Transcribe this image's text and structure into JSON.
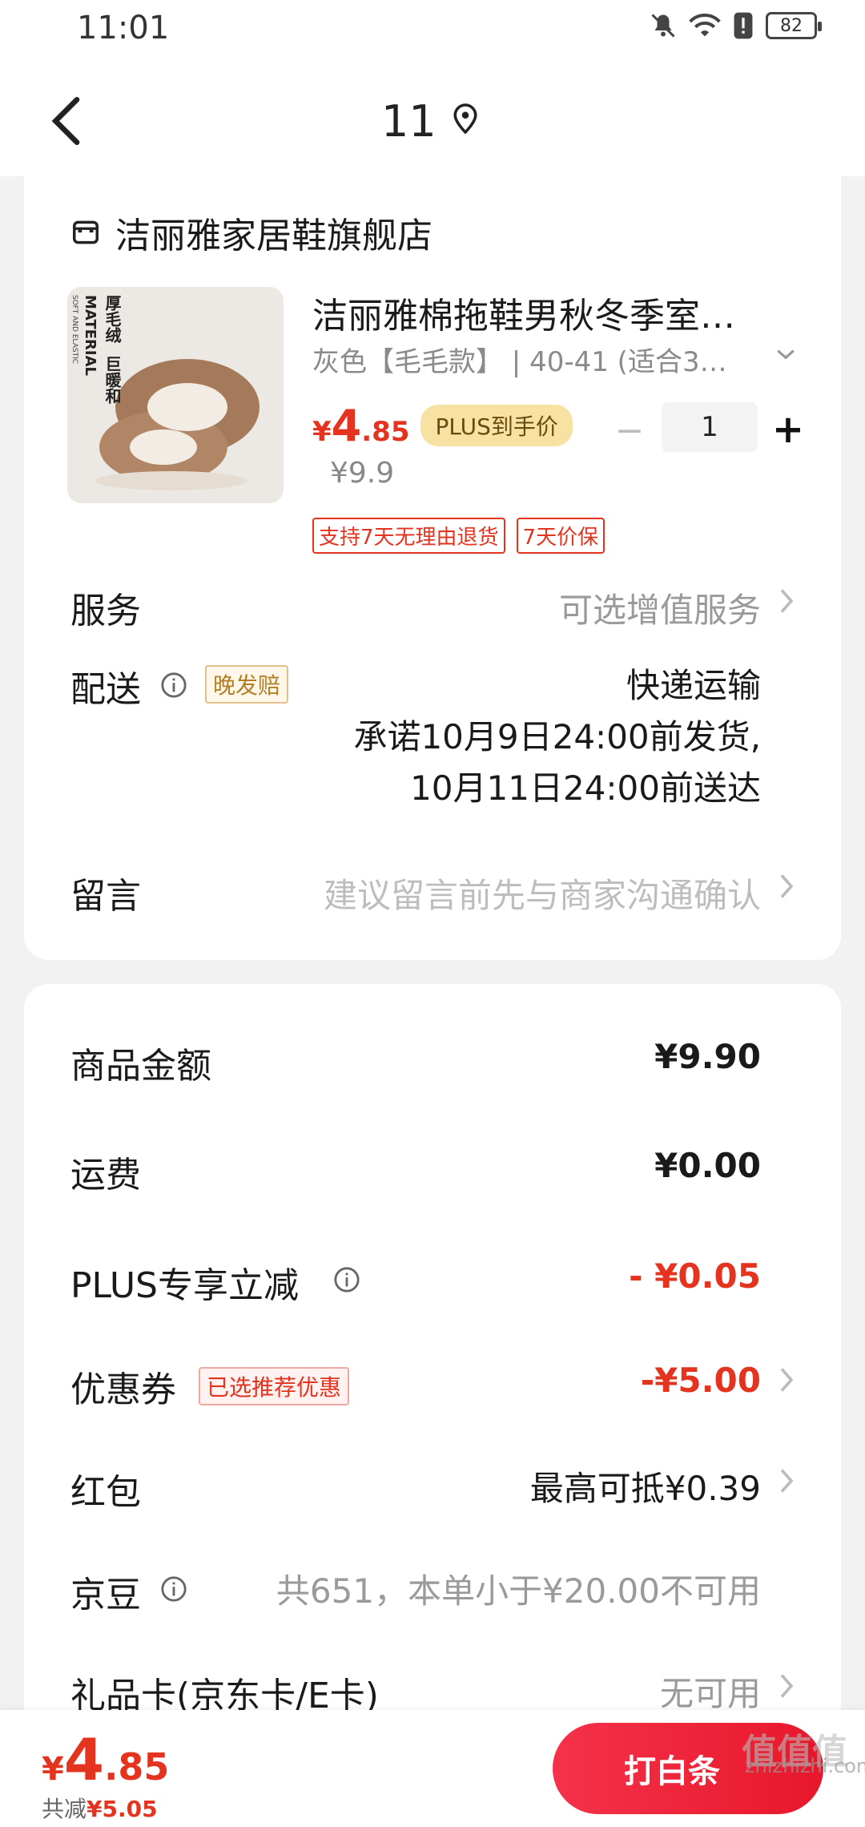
{
  "status_bar": {
    "time": "11:01",
    "battery": "82"
  },
  "nav": {
    "title": "11"
  },
  "shop": {
    "name": "洁丽雅家居鞋旗舰店"
  },
  "product": {
    "title": "洁丽雅棉拖鞋男秋冬季室…",
    "spec": "灰色【毛毛款】 | 40-41 (适合3…",
    "price_yen": "¥",
    "price_int": "4",
    "price_dec": ".85",
    "plus_badge": "PLUS到手价",
    "original_price": "¥9.9",
    "quantity": "1",
    "image_text": {
      "line1": "MATERIAL",
      "line2": "厚毛绒",
      "line3": "巨暖和",
      "line4": "SOFT AND ELASTIC"
    },
    "tags": [
      "支持7天无理由退货",
      "7天价保"
    ]
  },
  "service": {
    "label": "服务",
    "value": "可选增值服务"
  },
  "delivery": {
    "label": "配送",
    "badge": "晚发赔",
    "method": "快递运输",
    "line1": "承诺10月9日24:00前发货,",
    "line2": "10月11日24:00前送达"
  },
  "message": {
    "label": "留言",
    "placeholder": "建议留言前先与商家沟通确认"
  },
  "summary": {
    "goods_label": "商品金额",
    "goods_value": "¥9.90",
    "shipping_label": "运费",
    "shipping_value": "¥0.00",
    "plus_label": "PLUS专享立减",
    "plus_value": "- ¥0.05",
    "coupon_label": "优惠券",
    "coupon_badge": "已选推荐优惠",
    "coupon_value": "-¥5.00",
    "redpacket_label": "红包",
    "redpacket_value": "最高可抵¥0.39",
    "jingdou_label": "京豆",
    "jingdou_value": "共651，本单小于¥20.00不可用",
    "giftcard_label": "礼品卡(京东卡/E卡)",
    "giftcard_value": "无可用"
  },
  "bottom": {
    "total_yen": "¥",
    "total_int": "4",
    "total_dec": ".85",
    "saving_label": "共减",
    "saving_value": "¥5.05",
    "pay_button": "打白条"
  },
  "watermark": {
    "big": "值值值",
    "small": "zhizhizhi.com"
  },
  "colors": {
    "accent_red": "#e4331e",
    "plus_gold": "#f7e2a4",
    "background": "#f2f2f2"
  }
}
